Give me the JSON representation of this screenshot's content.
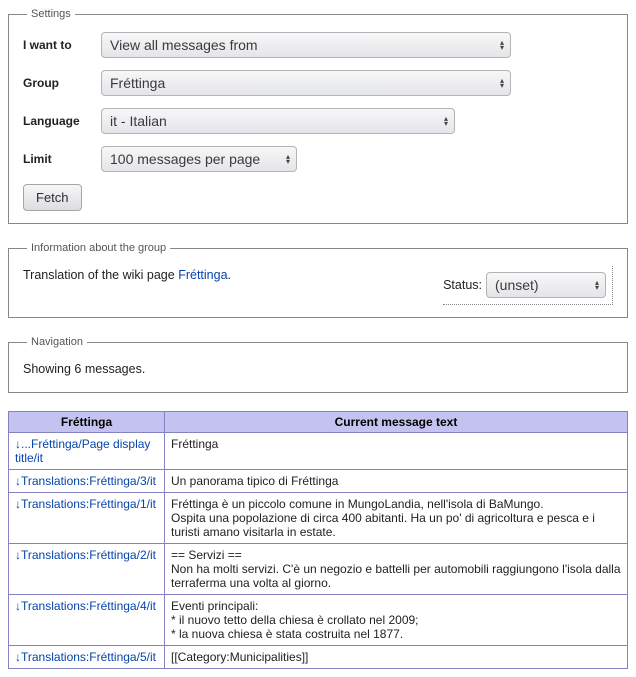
{
  "settings": {
    "legend": "Settings",
    "iwantto_label": "I want to",
    "iwantto_value": "View all messages from",
    "group_label": "Group",
    "group_value": "Fréttinga",
    "language_label": "Language",
    "language_value": "it - Italian",
    "limit_label": "Limit",
    "limit_value": "100 messages per page",
    "fetch_label": "Fetch"
  },
  "info": {
    "legend": "Information about the group",
    "prefix": "Translation of the wiki page ",
    "link": "Fréttinga",
    "suffix": ".",
    "status_label": "Status:",
    "status_value": "(unset)"
  },
  "nav": {
    "legend": "Navigation",
    "showing": "Showing 6 messages."
  },
  "table": {
    "col1": "Fréttinga",
    "col2": "Current message text",
    "rows": [
      {
        "link": "...Fréttinga/Page display title/it",
        "text": "Fréttinga"
      },
      {
        "link": "Translations:Fréttinga/3/it",
        "text": "Un panorama tipico di Fréttinga"
      },
      {
        "link": "Translations:Fréttinga/1/it",
        "text": "Fréttinga è un piccolo comune in MungoLandia, nell'isola di BaMungo.\nOspita una popolazione di circa 400 abitanti. Ha un po' di agricoltura e pesca e i turisti amano visitarla in estate."
      },
      {
        "link": "Translations:Fréttinga/2/it",
        "text": "== Servizi ==\nNon ha molti servizi. C'è un negozio e battelli per automobili raggiungono l'isola dalla terraferma una volta al giorno."
      },
      {
        "link": "Translations:Fréttinga/4/it",
        "text": "Eventi principali:\n* il nuovo tetto della chiesa è crollato nel 2009;\n* la nuova chiesa è stata costruita nel 1877."
      },
      {
        "link": "Translations:Fréttinga/5/it",
        "text": "[[Category:Municipalities]]"
      }
    ]
  }
}
